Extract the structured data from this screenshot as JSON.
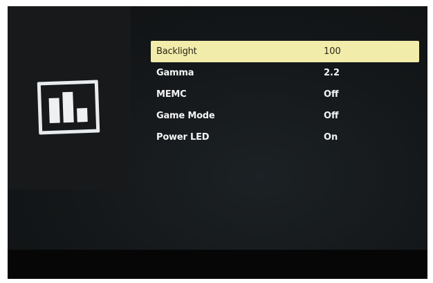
{
  "colors": {
    "screen_bg": "#141719",
    "highlight": "#f1ecaa",
    "text": "#f4f4f4",
    "selected_text": "#2a2516"
  },
  "sidebar": {
    "category_icon": "picture-settings-bar-chart-icon"
  },
  "menu": {
    "items": [
      {
        "label": "Backlight",
        "value": "100",
        "selected": true
      },
      {
        "label": "Gamma",
        "value": "2.2",
        "selected": false
      },
      {
        "label": "MEMC",
        "value": "Off",
        "selected": false
      },
      {
        "label": "Game Mode",
        "value": "Off",
        "selected": false
      },
      {
        "label": "Power LED",
        "value": "On",
        "selected": false
      }
    ]
  }
}
